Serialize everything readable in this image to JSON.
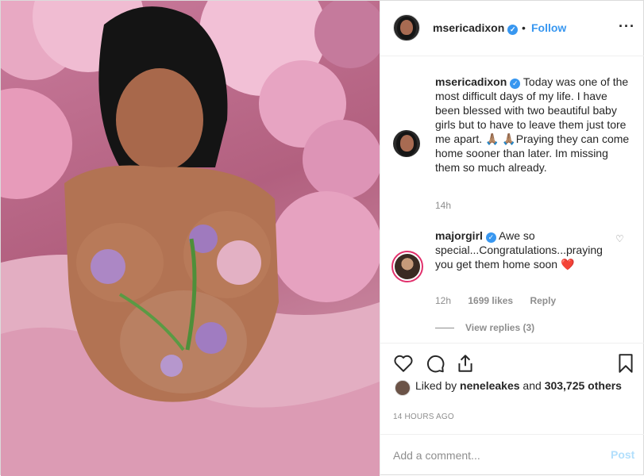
{
  "post": {
    "author": "msericadixon",
    "follow_label": "Follow",
    "separator": "•",
    "more_label": "···"
  },
  "caption": {
    "username": "msericadixon",
    "text": " Today was one of the most difficult days of my life. I have been blessed with two beautiful baby girls but to have to leave them just tore me apart. 🙏🏽 🙏🏽Praying they can come home sooner than later. Im missing them so much already.",
    "time": "14h"
  },
  "comment": {
    "username": "majorgirl",
    "text": " Awe so special...Congratulations...praying you get them home soon ❤️",
    "time": "12h",
    "likes": "1699 likes",
    "reply_label": "Reply",
    "view_replies": "View replies (3)"
  },
  "likes": {
    "prefix": "Liked by ",
    "first_liker": "neneleakes",
    "middle": " and ",
    "others": "303,725 others"
  },
  "timestamp": "14 HOURS AGO",
  "add_comment": {
    "placeholder": "Add a comment...",
    "post_label": "Post"
  },
  "icons": {
    "like": "heart-icon",
    "comment": "comment-icon",
    "share": "share-icon",
    "save": "bookmark-icon",
    "verified": "verified-badge-icon"
  },
  "colors": {
    "link_blue": "#3897f0",
    "muted": "#8e8e8e",
    "post_disabled": "#b2dffc",
    "photo_pink": "#d9a1b6"
  }
}
